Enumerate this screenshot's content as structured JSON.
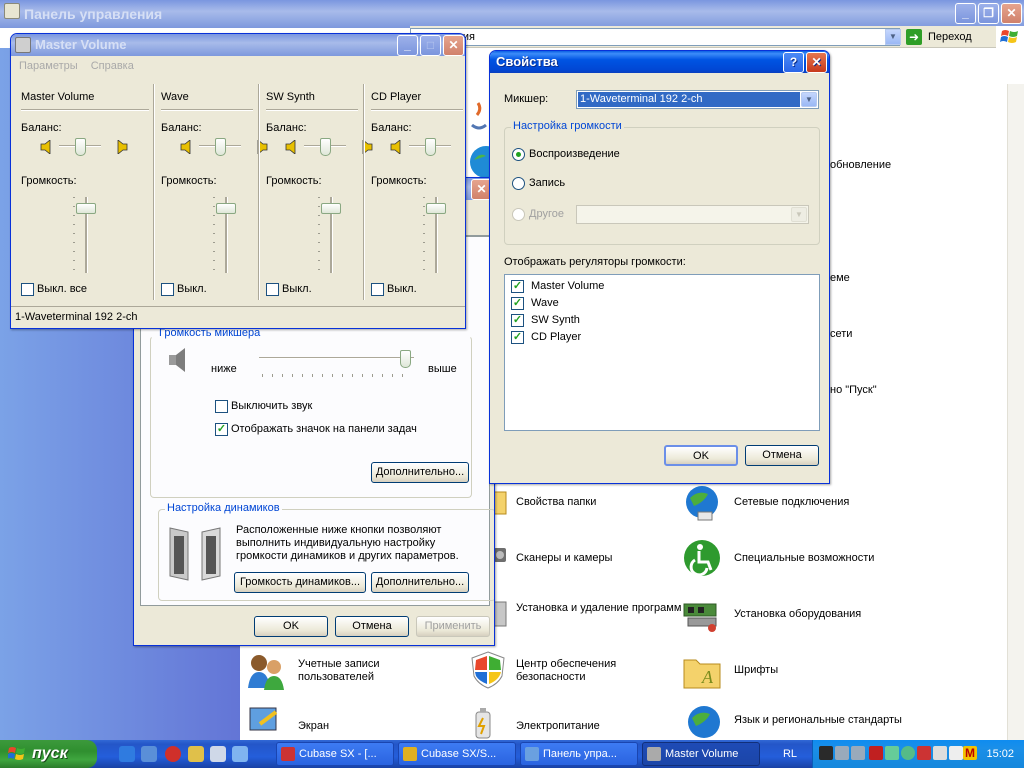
{
  "control_panel": {
    "title": "Панель управления",
    "address_value": "управления",
    "go_label": "Переход",
    "items": [
      {
        "label": "Свойства папки",
        "icon": "folder-options-icon"
      },
      {
        "label": "Сетевые подключения",
        "icon": "network-connections-icon"
      },
      {
        "label": "Сканеры и камеры",
        "icon": "scanner-camera-icon"
      },
      {
        "label": "Специальные возможности",
        "icon": "accessibility-icon"
      },
      {
        "label": "Установка и удаление программ",
        "icon": "add-remove-programs-icon"
      },
      {
        "label": "Установка оборудования",
        "icon": "add-hardware-icon"
      },
      {
        "label": "Учетные записи пользователей",
        "icon": "user-accounts-icon"
      },
      {
        "label": "Центр обеспечения безопасности",
        "icon": "security-center-icon"
      },
      {
        "label": "Шрифты",
        "icon": "fonts-icon"
      },
      {
        "label": "Экран",
        "icon": "display-icon"
      },
      {
        "label": "Электропитание",
        "icon": "power-options-icon"
      },
      {
        "label": "Язык и региональные стандарты",
        "icon": "regional-options-icon"
      }
    ],
    "partial_labels": {
      "update": "обновление",
      "scheme": "еме",
      "network": "сети",
      "start": "но \"Пуск\""
    }
  },
  "master_volume": {
    "title": "Master Volume",
    "menu": [
      "Параметры",
      "Справка"
    ],
    "balance_label": "Баланс:",
    "volume_label": "Громкость:",
    "channels": [
      {
        "name": "Master Volume",
        "mute_label": "Выкл. все",
        "muted": false,
        "volume": 0.92,
        "balance": 0.5
      },
      {
        "name": "Wave",
        "mute_label": "Выкл.",
        "muted": false,
        "volume": 0.92,
        "balance": 0.5
      },
      {
        "name": "SW Synth",
        "mute_label": "Выкл.",
        "muted": false,
        "volume": 0.92,
        "balance": 0.5
      },
      {
        "name": "CD Player",
        "mute_label": "Выкл.",
        "muted": false,
        "volume": 0.92,
        "balance": 0.5
      }
    ],
    "status": "1-Waveterminal 192 2-ch"
  },
  "sound_props": {
    "mixer_volume_group": "Громкость микшера",
    "low_label": "ниже",
    "high_label": "выше",
    "volume_level": 0.98,
    "mute_label": "Выключить звук",
    "mute_checked": false,
    "tray_label": "Отображать значок на панели задач",
    "tray_checked": true,
    "advanced_label": "Дополнительно...",
    "speakers_group": "Настройка динамиков",
    "speakers_text": "Расположенные ниже кнопки позволяют выполнить индивидуальную настройку громкости динамиков и других параметров.",
    "speaker_volume_label": "Громкость динамиков...",
    "speaker_advanced_label": "Дополнительно...",
    "ok": "OK",
    "cancel": "Отмена",
    "apply": "Применить"
  },
  "properties": {
    "title": "Свойства",
    "mixer_label": "Микшер:",
    "mixer_value": "1-Waveterminal 192 2-ch",
    "group_label": "Настройка громкости",
    "radio_playback": "Воспроизведение",
    "radio_record": "Запись",
    "radio_other": "Другое",
    "selected": "playback",
    "show_label": "Отображать регуляторы громкости:",
    "controls": [
      {
        "label": "Master Volume",
        "checked": true
      },
      {
        "label": "Wave",
        "checked": true
      },
      {
        "label": "SW Synth",
        "checked": true
      },
      {
        "label": "CD Player",
        "checked": true
      }
    ],
    "ok": "OK",
    "cancel": "Отмена"
  },
  "taskbar": {
    "start_label": "пуск",
    "tasks": [
      {
        "label": "Cubase SX - [...",
        "icon": "cubase-icon",
        "active": false
      },
      {
        "label": "Cubase SX/S...",
        "icon": "cubase-folder-icon",
        "active": false
      },
      {
        "label": "Панель упра...",
        "icon": "control-panel-icon",
        "active": false
      },
      {
        "label": "Master Volume",
        "icon": "volume-icon",
        "active": true
      }
    ],
    "language": "RL",
    "time": "15:02"
  },
  "colors": {
    "accent": "#0054e3",
    "desktop": "#3a6ea5",
    "checkmark": "#21a121",
    "group_label": "#0046d5"
  }
}
